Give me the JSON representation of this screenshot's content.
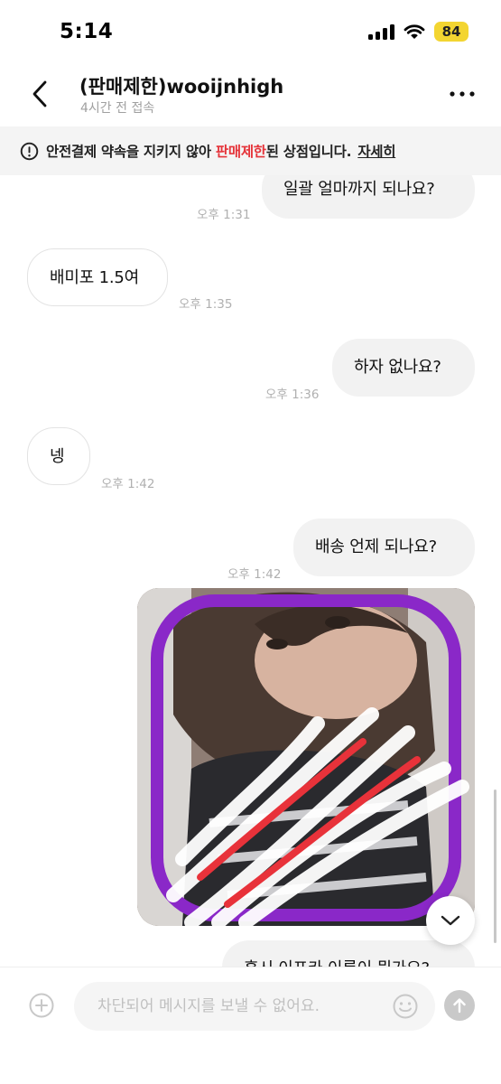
{
  "status_bar": {
    "time": "5:14",
    "battery": "84",
    "icons": [
      "signal-icon",
      "wifi-icon",
      "battery-icon"
    ]
  },
  "header": {
    "title": "(판매제한)wooijnhigh",
    "subtitle": "4시간 전 접속",
    "icons": [
      "back-arrow-icon",
      "more-dots-icon"
    ]
  },
  "notice": {
    "text_before": "안전결제 약속을 지키지 않아 ",
    "text_highlight": "판매제한",
    "text_after": "된 상점입니다.",
    "link": "자세히",
    "highlight_color": "#e5343a"
  },
  "messages": [
    {
      "side": "mine",
      "text": "일괄 얼마까지 되나요?",
      "time": "오후 1:31"
    },
    {
      "side": "theirs",
      "text": "배미포 1.5여",
      "time": "오후 1:35"
    },
    {
      "side": "mine",
      "text": "하자 없나요?",
      "time": "오후 1:36"
    },
    {
      "side": "theirs",
      "text": "넹",
      "time": "오후 1:42"
    },
    {
      "side": "mine",
      "text": "배송 언제 되나요?",
      "time": "오후 1:42"
    },
    {
      "side": "mine",
      "text": "혹시 이프카 이름이 뭔가요?",
      "time": ""
    }
  ],
  "photo": {
    "description_icon": "photo-image"
  },
  "input": {
    "placeholder": "차단되어 메시지를 보낼 수 없어요."
  },
  "colors": {
    "accent_red": "#e5343a",
    "battery_yellow": "#f3d531",
    "bubble_gray": "#f2f2f2"
  }
}
